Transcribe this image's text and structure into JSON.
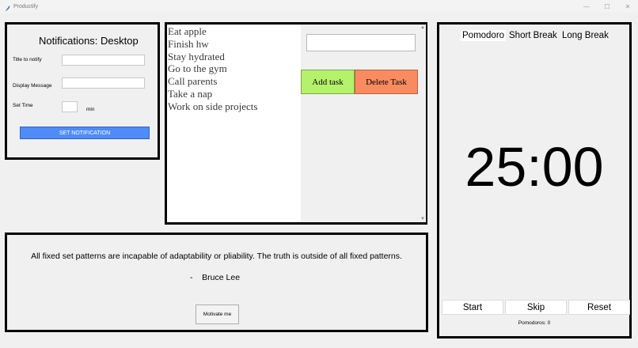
{
  "window": {
    "title": "Productify",
    "controls": [
      "—",
      "☐",
      "✕"
    ]
  },
  "notifications": {
    "title": "Notifications: Desktop",
    "title_label": "Title to notify",
    "title_value": "",
    "message_label": "Display Message",
    "message_value": "",
    "time_label": "Set Time",
    "time_value": "",
    "time_unit": "min",
    "button_label": "SET NOTIFICATION"
  },
  "tasks": {
    "items": [
      "Eat apple",
      "Finish hw",
      "Stay hydrated",
      "Go to the gym",
      "Call parents",
      "Take a nap",
      "Work on side projects"
    ],
    "input_value": "",
    "add_label": "Add task",
    "delete_label": "Delete Task"
  },
  "quote": {
    "text": "All fixed set patterns are incapable of adaptability or pliability. The truth is outside of all fixed patterns.",
    "author": "-    Bruce Lee",
    "button_label": "Motivate me"
  },
  "pomodoro": {
    "tabs": [
      "Pomodoro",
      "Short Break",
      "Long Break"
    ],
    "active_tab": "Pomodoro",
    "timer": "25:00",
    "start_label": "Start",
    "skip_label": "Skip",
    "reset_label": "Reset",
    "count_text": "Pomodoros: 0"
  },
  "colors": {
    "set_notification_button": "#4f8cf7",
    "add_task_button": "#b5f26b",
    "delete_task_button": "#f88c60"
  }
}
